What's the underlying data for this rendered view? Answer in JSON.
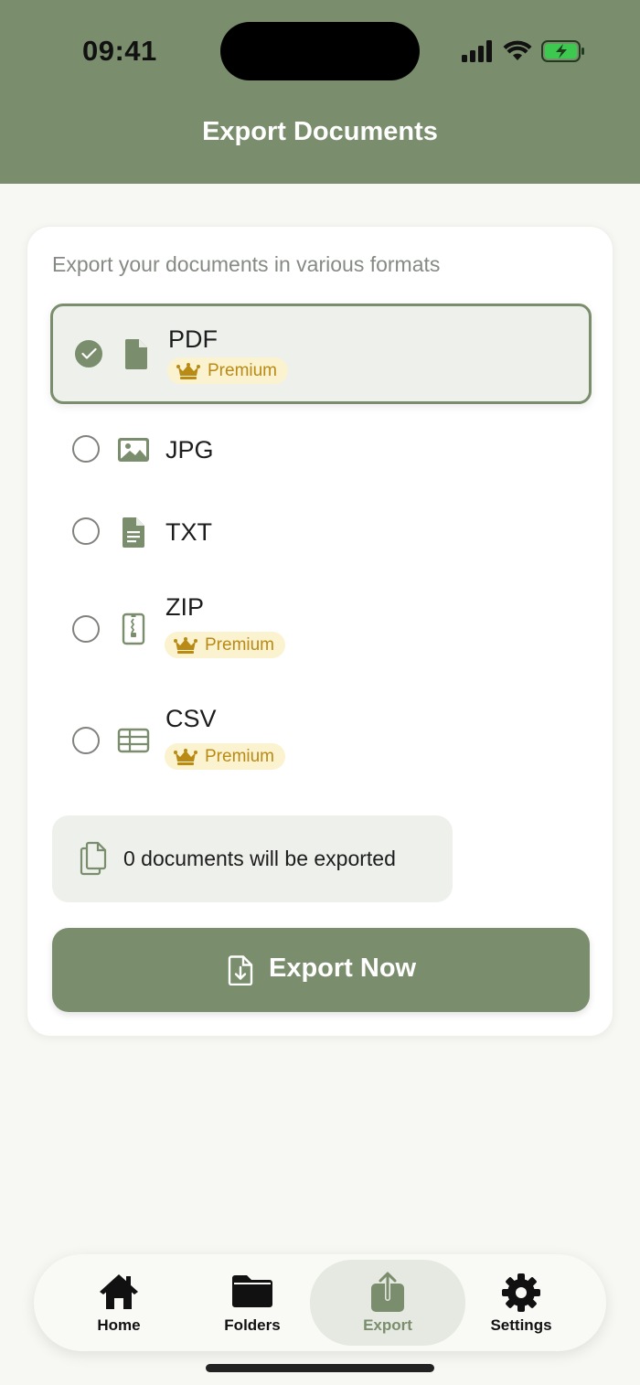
{
  "status_bar": {
    "time": "09:41"
  },
  "header": {
    "title": "Export Documents"
  },
  "card": {
    "subtitle": "Export your documents in various formats",
    "options": [
      {
        "label": "PDF",
        "icon": "pdf-file-icon",
        "premium": true,
        "selected": true
      },
      {
        "label": "JPG",
        "icon": "image-icon",
        "premium": false,
        "selected": false
      },
      {
        "label": "TXT",
        "icon": "text-file-icon",
        "premium": false,
        "selected": false
      },
      {
        "label": "ZIP",
        "icon": "zip-file-icon",
        "premium": true,
        "selected": false
      },
      {
        "label": "CSV",
        "icon": "table-icon",
        "premium": true,
        "selected": false
      }
    ],
    "premium_label": "Premium",
    "summary": "0 documents will be exported",
    "export_button": "Export Now"
  },
  "tabbar": {
    "tabs": [
      {
        "label": "Home",
        "icon": "home-icon",
        "active": false
      },
      {
        "label": "Folders",
        "icon": "folder-icon",
        "active": false
      },
      {
        "label": "Export",
        "icon": "share-icon",
        "active": true
      },
      {
        "label": "Settings",
        "icon": "gear-icon",
        "active": false
      }
    ]
  },
  "colors": {
    "accent": "#7a8d6c",
    "premium_bg": "#fbf2cf",
    "premium_text": "#b98a14",
    "background": "#f7f8f4"
  }
}
